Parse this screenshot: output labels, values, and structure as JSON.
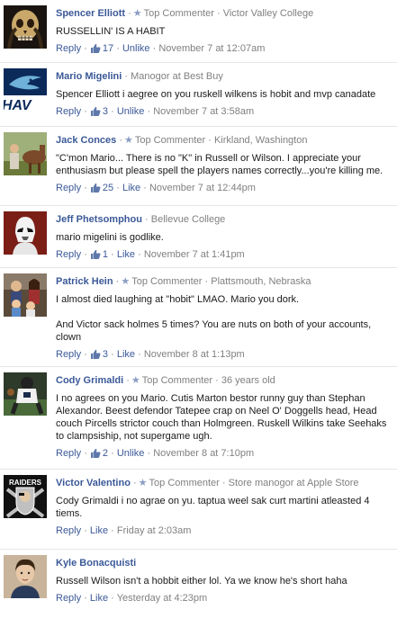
{
  "labels": {
    "reply": "Reply",
    "like": "Like",
    "unlike": "Unlike",
    "separator": "·",
    "top_commenter": "Top Commenter"
  },
  "comments": [
    {
      "name": "Spencer Elliott",
      "top_commenter": true,
      "affiliation": "Victor Valley College",
      "text": [
        "RUSSELLIN' IS A HABIT"
      ],
      "likes": "17",
      "like_action": "Unlike",
      "time": "November 7 at 12:07am",
      "avatar_icon": "skull-icon",
      "avatar_color": "#1a1410"
    },
    {
      "name": "Mario Migelini",
      "top_commenter": false,
      "affiliation": "Manogor at Best Buy",
      "text": [
        "Spencer Elliott i aegree on you ruskell wilkens is hobit and mvp canadate"
      ],
      "likes": "3",
      "like_action": "Unlike",
      "time": "November 7 at 3:58am",
      "avatar_icon": "seahawks-logo-icon",
      "avatar_color": "#0b2a5a",
      "avatar_text": "HAV"
    },
    {
      "name": "Jack Conces",
      "top_commenter": true,
      "affiliation": "Kirkland, Washington",
      "text": [
        "\"C'mon Mario... There is no \"K\" in Russell or Wilson. I appreciate your enthusiasm but please spell the players names correctly...you're killing me."
      ],
      "likes": "25",
      "like_action": "Like",
      "time": "November 7 at 12:44pm",
      "avatar_icon": "person-with-horse-icon",
      "avatar_color": "#6b7a3a"
    },
    {
      "name": "Jeff Phetsomphou",
      "top_commenter": false,
      "affiliation": "Bellevue College",
      "text": [
        "mario migelini is godlike."
      ],
      "likes": "1",
      "like_action": "Like",
      "time": "November 7 at 1:41pm",
      "avatar_icon": "stormtrooper-icon",
      "avatar_color": "#7a1e16"
    },
    {
      "name": "Patrick Hein",
      "top_commenter": true,
      "affiliation": "Plattsmouth, Nebraska",
      "text": [
        "I almost died laughing at \"hobit\" LMAO. Mario you dork.",
        "And Victor sack holmes 5 times? You are nuts on both of your accounts, clown"
      ],
      "likes": "3",
      "like_action": "Like",
      "time": "November 8 at 1:13pm",
      "avatar_icon": "family-photo-icon",
      "avatar_color": "#5a4a3a"
    },
    {
      "name": "Cody Grimaldi",
      "top_commenter": true,
      "affiliation": "36 years old",
      "text": [
        "I no agrees on you Mario. Cutis Marton bestor runny guy than Stephan Alexandor. Beest defendor Tatepee crap on Neel O' Doggells head, Head couch Pircells strictor couch than Holmgreen. Ruskell Wilkins take Seehaks to clampsiship, not supergame ugh."
      ],
      "likes": "2",
      "like_action": "Unlike",
      "time": "November 8 at 7:10pm",
      "avatar_icon": "football-player-icon",
      "avatar_color": "#2e3a2a"
    },
    {
      "name": "Victor Valentino",
      "top_commenter": true,
      "affiliation": "Store manogor at Apple Store",
      "text": [
        "Cody Grimaldi i no agrae on yu. taptua weel sak curt martini atleasted 4 tiems."
      ],
      "likes": "",
      "like_action": "Like",
      "time": "Friday at 2:03am",
      "avatar_icon": "raiders-logo-icon",
      "avatar_color": "#111111",
      "avatar_text": "RAIDERS"
    },
    {
      "name": "Kyle Bonacquisti",
      "top_commenter": false,
      "affiliation": "",
      "text": [
        "Russell Wilson isn't a hobbit either lol. Ya we know he's short haha"
      ],
      "likes": "",
      "like_action": "Like",
      "time": "Yesterday at 4:23pm",
      "avatar_icon": "person-portrait-icon",
      "avatar_color": "#c8b49a"
    }
  ]
}
